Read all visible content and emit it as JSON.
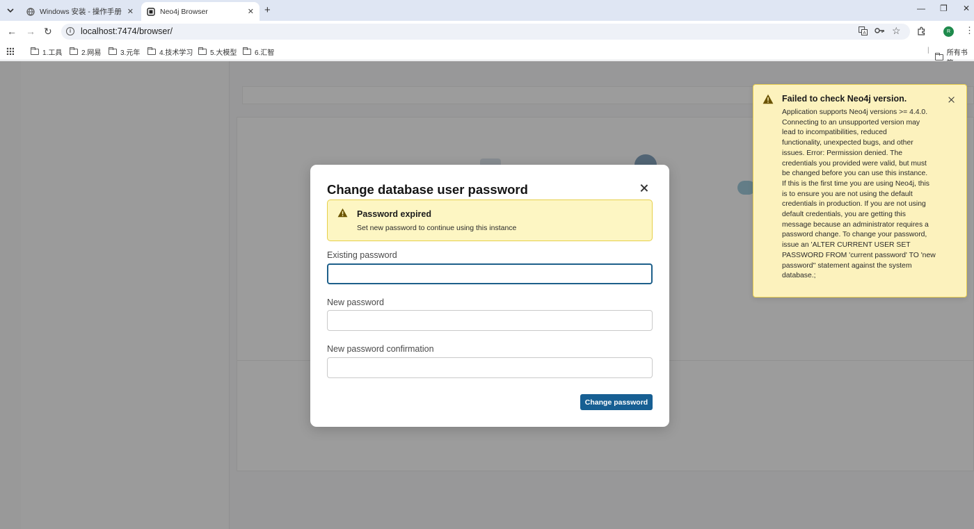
{
  "browser": {
    "tabs": [
      {
        "title": "Windows 安装 - 操作手册 - Ne",
        "active": false
      },
      {
        "title": "Neo4j Browser",
        "active": true
      }
    ],
    "url": "localhost:7474/browser/",
    "bookmarks": [
      "1.工具",
      "2.网易",
      "3.元年",
      "4.技术学习",
      "5.大模型",
      "6.汇智"
    ],
    "all_bookmarks_label": "所有书签",
    "avatar_initials": "R"
  },
  "modal": {
    "title": "Change database user password",
    "warning": {
      "title": "Password expired",
      "text": "Set new password to continue using this instance"
    },
    "fields": [
      {
        "label": "Existing password",
        "value": ""
      },
      {
        "label": "New password",
        "value": ""
      },
      {
        "label": "New password confirmation",
        "value": ""
      }
    ],
    "submit_label": "Change password"
  },
  "toast": {
    "title": "Failed to check Neo4j version.",
    "lines": [
      "Application supports Neo4j versions >= 4.4.0.",
      "Connecting to an unsupported version may",
      "lead to incompatibilities, reduced",
      "functionality, unexpected bugs, and other",
      "issues. Error: Permission denied. The",
      "credentials you provided were valid, but must",
      "be changed before you can use this instance.",
      "If this is the first time you are using Neo4j, this",
      "is to ensure you are not using the default",
      "credentials in production. If you are not using",
      "default credentials, you are getting this",
      "message because an administrator requires a",
      "password change. To change your password,",
      "issue an 'ALTER CURRENT USER SET",
      "PASSWORD FROM 'current password' TO 'new",
      "password'' statement against the system",
      "database.;"
    ]
  },
  "colors": {
    "primary_button": "#175f93",
    "warning_bg": "#fdf6c3",
    "warning_icon": "#6b5400"
  }
}
